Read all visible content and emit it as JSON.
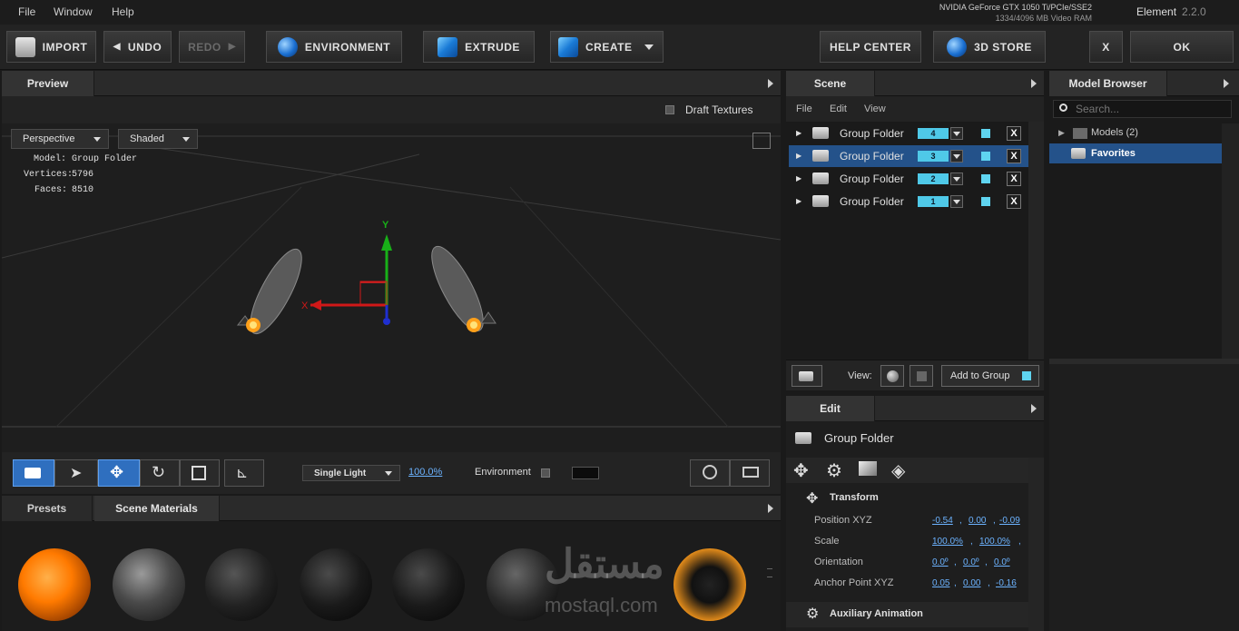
{
  "menu": {
    "items": [
      "File",
      "Window",
      "Help"
    ]
  },
  "gpu": {
    "line1": "NVIDIA GeForce GTX 1050 Ti/PCIe/SSE2",
    "line2": "1334/4096 MB Video RAM"
  },
  "app": {
    "name": "Element",
    "version": "2.2.0"
  },
  "toolbar": {
    "import": "IMPORT",
    "undo": "UNDO",
    "redo": "REDO",
    "environment": "ENVIRONMENT",
    "extrude": "EXTRUDE",
    "create": "CREATE",
    "help": "HELP CENTER",
    "store": "3D STORE",
    "close": "X",
    "ok": "OK"
  },
  "preview": {
    "tab": "Preview",
    "draft": "Draft Textures",
    "camera": "Perspective",
    "shading": "Shaded",
    "model_label": "Model:",
    "model": "Group Folder",
    "vertices_label": "Vertices:",
    "vertices": "5796",
    "faces_label": "Faces:",
    "faces": "8510",
    "axis_y": "Y",
    "axis_x": "X",
    "light": "Single Light",
    "light_pct": "100.0%",
    "env_label": "Environment"
  },
  "presets": {
    "tabs": [
      "Presets",
      "Scene Materials"
    ]
  },
  "scene": {
    "tab": "Scene",
    "menu": [
      "File",
      "Edit",
      "View"
    ],
    "rows": [
      {
        "label": "Group Folder",
        "num": "4",
        "selected": false
      },
      {
        "label": "Group Folder",
        "num": "3",
        "selected": true
      },
      {
        "label": "Group Folder",
        "num": "2",
        "selected": false
      },
      {
        "label": "Group Folder",
        "num": "1",
        "selected": false
      }
    ],
    "x": "X",
    "view_label": "View:",
    "add_group": "Add to Group"
  },
  "edit": {
    "tab": "Edit",
    "title": "Group Folder",
    "transform": "Transform",
    "props": [
      {
        "label": "Position XYZ",
        "vals": [
          "-0.54",
          "0.00",
          "-0.09"
        ]
      },
      {
        "label": "Scale",
        "vals": [
          "100.0%",
          "100.0%",
          ""
        ]
      },
      {
        "label": "Orientation",
        "vals": [
          "0.0º",
          "0.0º",
          "0.0º"
        ]
      },
      {
        "label": "Anchor Point XYZ",
        "vals": [
          "0.05",
          "0.00",
          "-0.16"
        ]
      }
    ],
    "aux": "Auxiliary Animation"
  },
  "browser": {
    "tab": "Model Browser",
    "search_placeholder": "Search...",
    "models": "Models (2)",
    "favorites": "Favorites"
  },
  "watermark": {
    "arabic": "مستقل",
    "latin": "mostaql.com"
  },
  "colors": {
    "accent": "#4fc9e8",
    "selection": "#24528a",
    "link": "#6cb3ff",
    "thruster": "#ffa01a"
  }
}
